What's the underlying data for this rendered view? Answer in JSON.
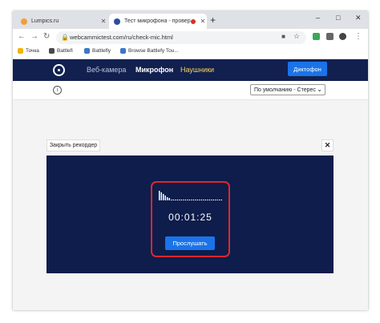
{
  "browser": {
    "tabs": [
      {
        "title": "Lumpics.ru",
        "favicon_color": "#f29d38"
      },
      {
        "title": "Тест микрофона - проверк",
        "favicon_color": "#2a4f9e",
        "recording": true
      }
    ],
    "url": "webcammictest.com/ru/check-mic.html",
    "bookmarks": [
      {
        "label": "Точка",
        "icon_color": "#f4b400"
      },
      {
        "label": "Battlefi",
        "icon_color": "#4a4a4a"
      },
      {
        "label": "Battlefly",
        "icon_color": "#3b77c9"
      },
      {
        "label": "Browse Battlefy Tou...",
        "icon_color": "#3b77c9"
      }
    ],
    "window_controls": {
      "minimize": "–",
      "maximize": "□",
      "close": "✕"
    }
  },
  "site": {
    "nav": [
      {
        "label": "Веб-камера",
        "state": "dim"
      },
      {
        "label": "Микрофон",
        "state": "active"
      },
      {
        "label": "Наушники",
        "state": "highlight"
      }
    ],
    "dictaphone_button": "Диктофон",
    "device_select": "По умолчанию - Стерес",
    "close_recorder": "Закрыть рекордер",
    "close_x": "✕",
    "recorder": {
      "time": "00:01:25",
      "play_button": "Прослушать"
    }
  },
  "colors": {
    "nav_bg": "#12204f",
    "panel_bg": "#0e1d4b",
    "accent_blue": "#1a73e8",
    "highlight_border": "#e0262e",
    "nav_highlight": "#f5d35b"
  }
}
